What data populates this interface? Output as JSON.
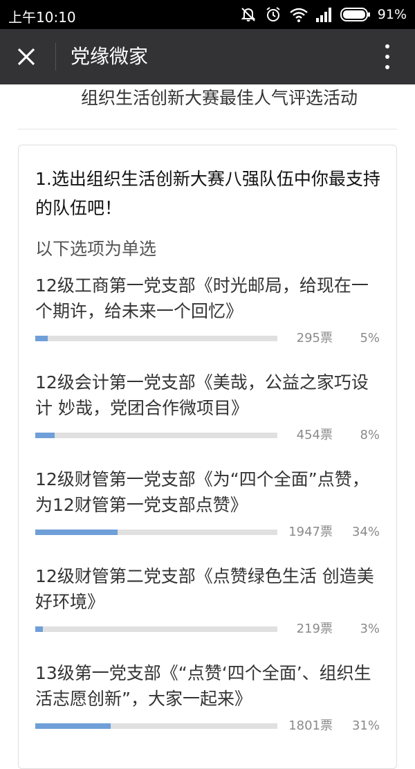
{
  "status_bar": {
    "time": "上午10:10",
    "battery": "91%",
    "icons": [
      "mute-icon",
      "alarm-icon",
      "wifi-icon",
      "signal-icon",
      "battery-icon"
    ]
  },
  "navbar": {
    "title": "党缘微家",
    "close_icon": "close-icon",
    "more_icon": "more-vertical-icon"
  },
  "page": {
    "heading": "组织生活创新大赛最佳人气评选活动"
  },
  "poll": {
    "question": "1.选出组织生活创新大赛八强队伍中你最支持的队伍吧！",
    "single_choice_note": "以下选项为单选",
    "bar_color": "#6f9fd8",
    "options": [
      {
        "text": "12级工商第一党支部《时光邮局，给现在一个期许，给未来一个回忆》",
        "votes": "295票",
        "percent": "5%",
        "fraction": 0.05
      },
      {
        "text": "12级会计第一党支部《美哉，公益之家巧设计 妙哉，党团合作微项目》",
        "votes": "454票",
        "percent": "8%",
        "fraction": 0.08
      },
      {
        "text": "12级财管第一党支部《为“四个全面”点赞，为12财管第一党支部点赞》",
        "votes": "1947票",
        "percent": "34%",
        "fraction": 0.34
      },
      {
        "text": "12级财管第二党支部《点赞绿色生活 创造美好环境》",
        "votes": "219票",
        "percent": "3%",
        "fraction": 0.03
      },
      {
        "text": "13级第一党支部《“点赞‘四个全面’、组织生活志愿创新”，大家一起来》",
        "votes": "1801票",
        "percent": "31%",
        "fraction": 0.31
      }
    ]
  }
}
